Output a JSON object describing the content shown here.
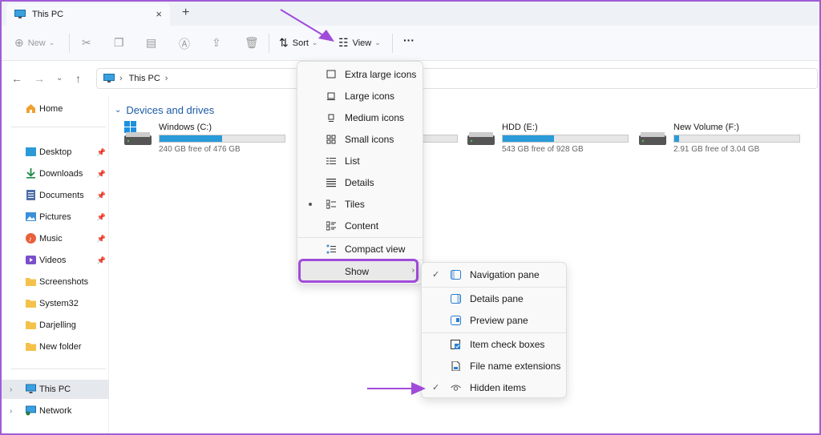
{
  "window": {
    "tab_title": "This PC",
    "new_tab": "+",
    "close": "×"
  },
  "toolbar": {
    "new_label": "New",
    "sort_label": "Sort",
    "view_label": "View",
    "more_label": "···"
  },
  "address": {
    "location": "This PC"
  },
  "sidebar": {
    "home": "Home",
    "quick_access": [
      {
        "label": "Desktop",
        "icon": "desktop-icon",
        "pinned": true
      },
      {
        "label": "Downloads",
        "icon": "downloads-icon",
        "pinned": true
      },
      {
        "label": "Documents",
        "icon": "documents-icon",
        "pinned": true
      },
      {
        "label": "Pictures",
        "icon": "pictures-icon",
        "pinned": true
      },
      {
        "label": "Music",
        "icon": "music-icon",
        "pinned": true
      },
      {
        "label": "Videos",
        "icon": "videos-icon",
        "pinned": true
      },
      {
        "label": "Screenshots",
        "icon": "folder-icon",
        "pinned": false
      },
      {
        "label": "System32",
        "icon": "folder-icon",
        "pinned": false
      },
      {
        "label": "Darjelling",
        "icon": "folder-icon",
        "pinned": false
      },
      {
        "label": "New folder",
        "icon": "folder-icon",
        "pinned": false
      }
    ],
    "this_pc": "This PC",
    "network": "Network"
  },
  "main": {
    "section_title": "Devices and drives",
    "drives": [
      {
        "name": "Windows (C:)",
        "free_text": "240 GB free of 476 GB",
        "used_fraction": 0.5
      },
      {
        "name": "",
        "free_text": "",
        "used_fraction": 0.0
      },
      {
        "name": "HDD (E:)",
        "free_text": "543 GB free of 928 GB",
        "used_fraction": 0.41
      },
      {
        "name": "New Volume (F:)",
        "free_text": "2.91 GB free of 3.04 GB",
        "used_fraction": 0.04
      }
    ]
  },
  "view_menu": {
    "items": [
      "Extra large icons",
      "Large icons",
      "Medium icons",
      "Small icons",
      "List",
      "Details",
      "Tiles",
      "Content"
    ],
    "selected": "Tiles",
    "compact_view": "Compact view",
    "show": "Show"
  },
  "show_submenu": {
    "items": [
      {
        "label": "Navigation pane",
        "checked": true
      },
      {
        "label": "Details pane",
        "checked": false
      },
      {
        "label": "Preview pane",
        "checked": false
      },
      {
        "label": "Item check boxes",
        "checked": false
      },
      {
        "label": "File name extensions",
        "checked": false
      },
      {
        "label": "Hidden items",
        "checked": true
      }
    ]
  },
  "colors": {
    "accent": "#2a9bd8",
    "highlight": "#a04bd9"
  }
}
